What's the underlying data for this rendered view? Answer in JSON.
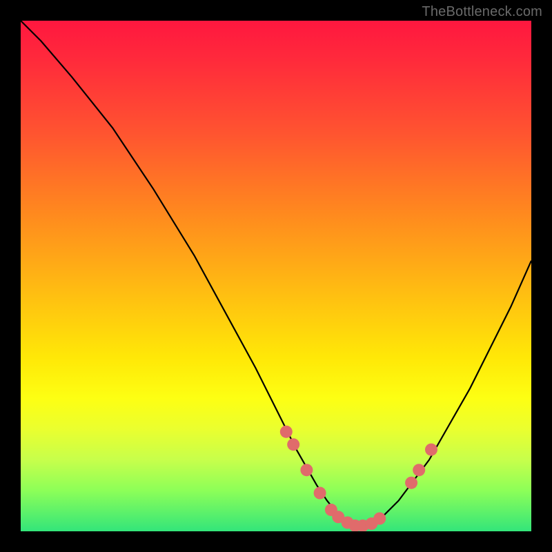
{
  "attribution": "TheBottleneck.com",
  "chart_data": {
    "type": "line",
    "title": "",
    "xlabel": "",
    "ylabel": "",
    "xlim": [
      0,
      100
    ],
    "ylim": [
      0,
      100
    ],
    "series": [
      {
        "name": "curve",
        "x": [
          0,
          4,
          10,
          18,
          26,
          34,
          40,
          46,
          50,
          54,
          58,
          60,
          62,
          64,
          66,
          68,
          70,
          74,
          80,
          88,
          96,
          100
        ],
        "y": [
          100,
          96,
          89,
          79,
          67,
          54,
          43,
          32,
          24,
          16,
          9,
          6,
          3.5,
          2,
          1,
          1,
          2,
          6,
          14,
          28,
          44,
          53
        ]
      }
    ],
    "markers": {
      "name": "dots",
      "color": "#e06b6b",
      "radius": 9,
      "points": [
        {
          "x": 52.0,
          "y": 19.5
        },
        {
          "x": 53.4,
          "y": 17.0
        },
        {
          "x": 56.0,
          "y": 12.0
        },
        {
          "x": 58.6,
          "y": 7.5
        },
        {
          "x": 60.8,
          "y": 4.2
        },
        {
          "x": 62.2,
          "y": 2.8
        },
        {
          "x": 64.0,
          "y": 1.7
        },
        {
          "x": 65.5,
          "y": 1.1
        },
        {
          "x": 67.0,
          "y": 1.1
        },
        {
          "x": 68.7,
          "y": 1.5
        },
        {
          "x": 70.3,
          "y": 2.5
        },
        {
          "x": 76.5,
          "y": 9.5
        },
        {
          "x": 78.0,
          "y": 12.0
        },
        {
          "x": 80.4,
          "y": 16.0
        }
      ]
    }
  }
}
